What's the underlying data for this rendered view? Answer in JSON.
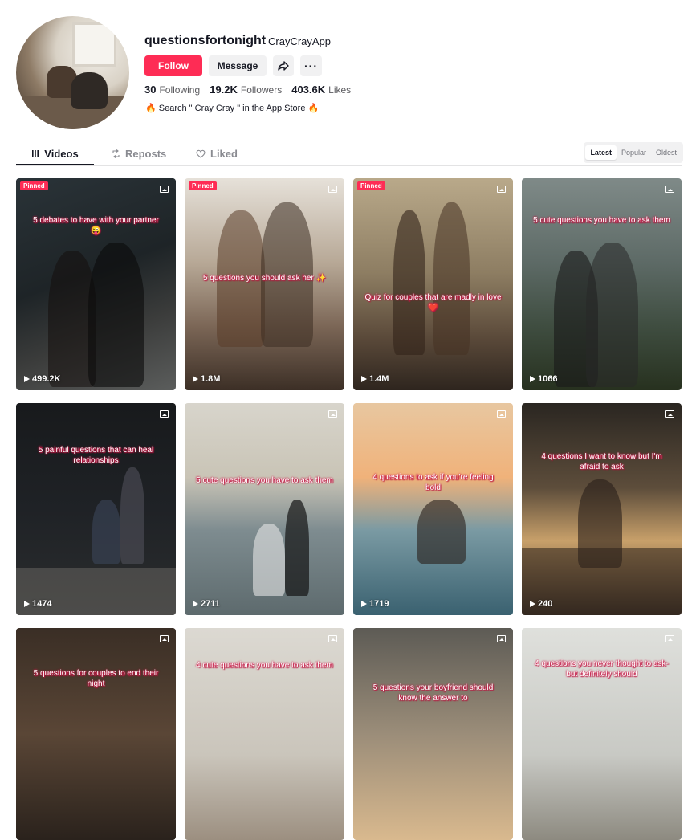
{
  "profile": {
    "username": "questionsfortonight",
    "nickname": "CrayCrayApp",
    "follow_label": "Follow",
    "message_label": "Message",
    "share_icon": "share-icon",
    "more_icon": "more-icon",
    "more_glyph": "···",
    "stats": {
      "following_count": "30",
      "following_label": "Following",
      "followers_count": "19.2K",
      "followers_label": "Followers",
      "likes_count": "403.6K",
      "likes_label": "Likes"
    },
    "bio": "Search \" Cray Cray \" in the App Store",
    "bio_icon": "fire-icon"
  },
  "tabs": [
    {
      "label": "Videos",
      "icon": "grid-icon"
    },
    {
      "label": "Reposts",
      "icon": "repost-icon"
    },
    {
      "label": "Liked",
      "icon": "heart-icon"
    }
  ],
  "sort": [
    "Latest",
    "Popular",
    "Oldest"
  ],
  "sort_active": "Latest",
  "videos": [
    {
      "pinned": "Pinned",
      "caption": "5 debates to have with your partner 😜",
      "views": "499.2K"
    },
    {
      "pinned": "Pinned",
      "caption": "5 questions you should ask her ✨",
      "views": "1.8M"
    },
    {
      "pinned": "Pinned",
      "caption": "Quiz for couples that are madly in love ❤️",
      "views": "1.4M"
    },
    {
      "pinned": "",
      "caption": "5 cute questions you have to ask them",
      "views": "1066"
    },
    {
      "pinned": "",
      "caption": "5 painful questions that can heal relationships",
      "views": "1474"
    },
    {
      "pinned": "",
      "caption": "5 cute questions you have to ask them",
      "views": "2711"
    },
    {
      "pinned": "",
      "caption": "4 questions to ask if you're feeling bold",
      "views": "1719"
    },
    {
      "pinned": "",
      "caption": "4 questions I want to know but I'm afraid to ask",
      "views": "240"
    },
    {
      "pinned": "",
      "caption": "5 questions for couples to end their night",
      "views": ""
    },
    {
      "pinned": "",
      "caption": "4 cute questions you have to ask them",
      "views": ""
    },
    {
      "pinned": "",
      "caption": "5 questions your boyfriend should know the answer to",
      "views": ""
    },
    {
      "pinned": "",
      "caption": "4 questions you never thought to ask- but definitely should",
      "views": ""
    }
  ],
  "colors": {
    "accent": "#fe2c55",
    "caption_outline": "#d11a4a"
  }
}
